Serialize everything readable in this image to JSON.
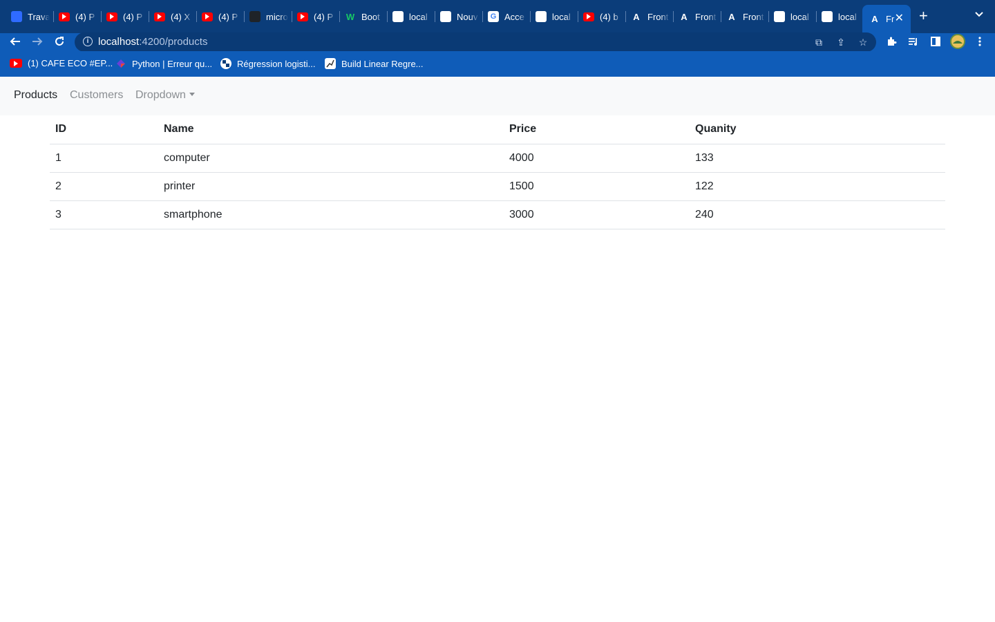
{
  "browser": {
    "tabs": [
      {
        "label": "Travail",
        "favicon": "person-icon"
      },
      {
        "label": "(4) P",
        "favicon": "youtube-icon"
      },
      {
        "label": "(4) P",
        "favicon": "youtube-icon"
      },
      {
        "label": "(4) X",
        "favicon": "youtube-icon"
      },
      {
        "label": "(4) P",
        "favicon": "youtube-icon"
      },
      {
        "label": "micro",
        "favicon": "github-icon"
      },
      {
        "label": "(4) P",
        "favicon": "youtube-icon"
      },
      {
        "label": "Boot",
        "favicon": "w-icon"
      },
      {
        "label": "local",
        "favicon": "globe-icon"
      },
      {
        "label": "Nouv",
        "favicon": "chrome-icon"
      },
      {
        "label": "Acce",
        "favicon": "google-icon"
      },
      {
        "label": "local",
        "favicon": "globe-icon"
      },
      {
        "label": "(4) b",
        "favicon": "youtube-icon"
      },
      {
        "label": "Front",
        "favicon": "angular-icon"
      },
      {
        "label": "Front",
        "favicon": "angular-icon"
      },
      {
        "label": "Front",
        "favicon": "angular-icon"
      },
      {
        "label": "local",
        "favicon": "globe-icon"
      },
      {
        "label": "local",
        "favicon": "globe-icon"
      },
      {
        "label": "Fr",
        "favicon": "angular-icon"
      }
    ],
    "active_tab_index": 18,
    "url_host": "localhost",
    "url_rest": ":4200/products",
    "bookmarks": [
      {
        "label": "(1) CAFE ECO #EP...",
        "favicon": "youtube-icon"
      },
      {
        "label": "Python | Erreur qu...",
        "favicon": "diamond-icon"
      },
      {
        "label": "Régression logisti...",
        "favicon": "python-icon"
      },
      {
        "label": "Build Linear Regre...",
        "favicon": "chart-icon"
      }
    ]
  },
  "navbar": {
    "products": "Products",
    "customers": "Customers",
    "dropdown": "Dropdown"
  },
  "table": {
    "headers": [
      "ID",
      "Name",
      "Price",
      "Quanity"
    ],
    "rows": [
      [
        "1",
        "computer",
        "4000",
        "133"
      ],
      [
        "2",
        "printer",
        "1500",
        "122"
      ],
      [
        "3",
        "smartphone",
        "3000",
        "240"
      ]
    ]
  }
}
